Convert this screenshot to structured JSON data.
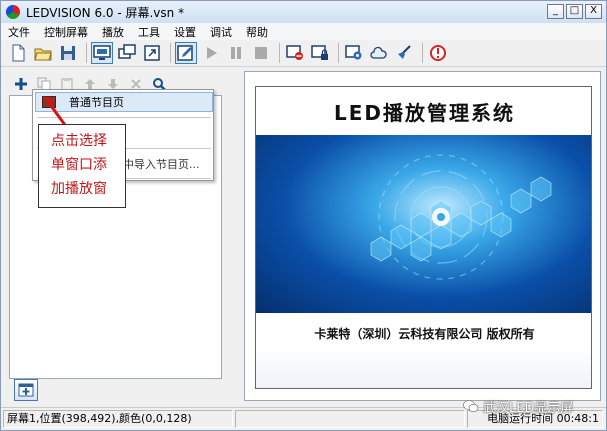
{
  "window": {
    "title": "LEDVISION 6.0 - 屏幕.vsn *",
    "controls": [
      "_",
      "□",
      "X"
    ]
  },
  "menu": [
    "文件",
    "控制屏幕",
    "播放",
    "工具",
    "设置",
    "调试",
    "帮助"
  ],
  "toolbar_icons": [
    "new-file-icon",
    "open-folder-icon",
    "save-icon",
    "screen-monitor-icon",
    "windowed-icon",
    "fullscreen-icon",
    "edit-icon",
    "play-icon",
    "pause-icon",
    "stop-icon",
    "screen-off-icon",
    "screen-lock-icon",
    "screen-settings-icon",
    "cloud-icon",
    "broom-icon",
    "info-icon"
  ],
  "left_panel": {
    "toolbar_icons": [
      "add-icon",
      "copy-icon",
      "paste-icon",
      "move-up-icon",
      "move-down-icon",
      "delete-icon",
      "search-icon"
    ],
    "popup": {
      "item1": "普通节目页",
      "item2": "中导入节目页..."
    },
    "callout": [
      "点击选择",
      "单窗口添",
      "加播放窗"
    ]
  },
  "preview": {
    "title": "LED播放管理系统",
    "footer": "卡莱特（深圳）云科技有限公司  版权所有"
  },
  "status": {
    "text": "屏幕1,位置(398,492),颜色(0,0,128)",
    "runtime": "电脑运行时间 00:48:1"
  },
  "watermark": "武汉LED显示屏",
  "colors": {
    "accent": "#3c7fb1",
    "callout_text": "#c01818",
    "preview_blue": "#0a4fa8"
  }
}
